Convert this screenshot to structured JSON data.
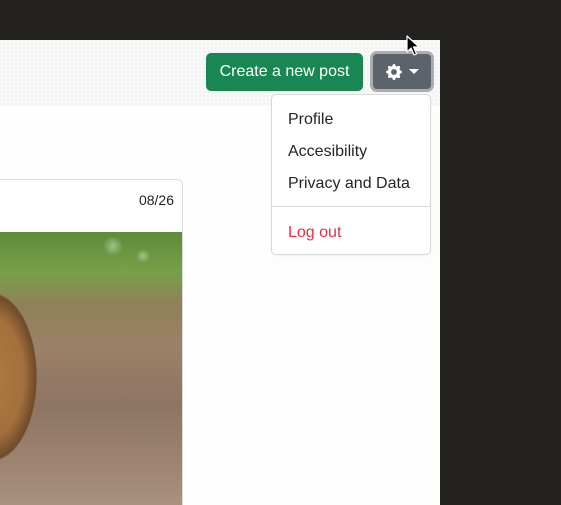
{
  "header": {
    "create_post_label": "Create a new post",
    "settings_icon": "gear-icon",
    "caret_icon": "caret-down-icon"
  },
  "post": {
    "date": "08/26"
  },
  "settings_menu": {
    "items": [
      {
        "label": "Profile"
      },
      {
        "label": "Accesibility"
      },
      {
        "label": "Privacy and Data"
      }
    ],
    "logout_label": "Log out"
  },
  "colors": {
    "primary_green": "#198754",
    "secondary_gray": "#5c636a",
    "danger_red": "#dc3545",
    "background_dark": "#23221e"
  }
}
